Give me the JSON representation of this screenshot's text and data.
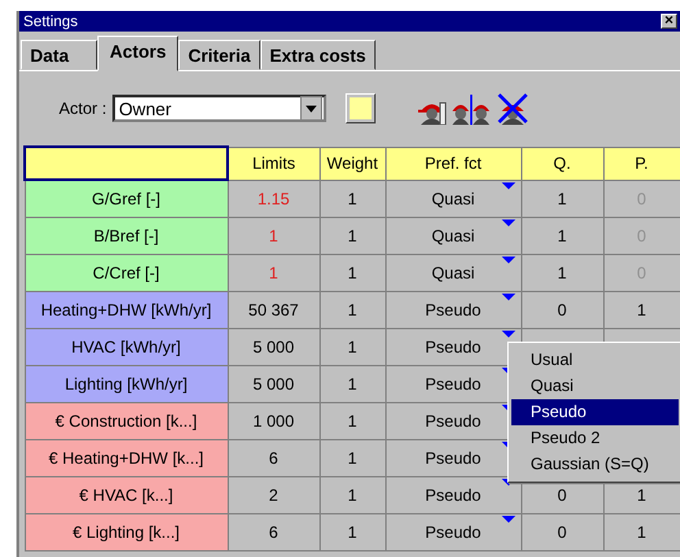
{
  "window": {
    "title": "Settings",
    "close": "×"
  },
  "tabs": [
    {
      "label": "Data",
      "selected": false
    },
    {
      "label": "Actors",
      "selected": true
    },
    {
      "label": "Criteria",
      "selected": false
    },
    {
      "label": "Extra costs",
      "selected": false
    }
  ],
  "actor": {
    "label": "Actor :",
    "value": "Owner",
    "color": "#ffff99"
  },
  "table": {
    "columns": [
      "",
      "Limits",
      "Weight",
      "Pref. fct",
      "Q.",
      "P."
    ],
    "rows": [
      {
        "name": "G/Gref [-]",
        "color": "#a8f8a8",
        "limit": "1.15",
        "limit_alert": true,
        "weight": "1",
        "pref": "Quasi",
        "q": "1",
        "p": "0",
        "p_disabled": true
      },
      {
        "name": "B/Bref [-]",
        "color": "#a8f8a8",
        "limit": "1",
        "limit_alert": true,
        "weight": "1",
        "pref": "Quasi",
        "q": "1",
        "p": "0",
        "p_disabled": true
      },
      {
        "name": "C/Cref [-]",
        "color": "#a8f8a8",
        "limit": "1",
        "limit_alert": true,
        "weight": "1",
        "pref": "Quasi",
        "q": "1",
        "p": "0",
        "p_disabled": true
      },
      {
        "name": "Heating+DHW [kWh/yr]",
        "color": "#a8a8f8",
        "limit": "50 367",
        "limit_alert": false,
        "weight": "1",
        "pref": "Pseudo",
        "q": "0",
        "p": "1",
        "p_disabled": false
      },
      {
        "name": "HVAC [kWh/yr]",
        "color": "#a8a8f8",
        "limit": "5 000",
        "limit_alert": false,
        "weight": "1",
        "pref": "Pseudo"
      },
      {
        "name": "Lighting [kWh/yr]",
        "color": "#a8a8f8",
        "limit": "5 000",
        "limit_alert": false,
        "weight": "1",
        "pref": "Pseudo"
      },
      {
        "name": "€ Construction [k...]",
        "color": "#f8a8a8",
        "limit": "1 000",
        "limit_alert": false,
        "weight": "1",
        "pref": "Pseudo"
      },
      {
        "name": "€ Heating+DHW [k...]",
        "color": "#f8a8a8",
        "limit": "6",
        "limit_alert": false,
        "weight": "1",
        "pref": "Pseudo"
      },
      {
        "name": "€ HVAC [k...]",
        "color": "#f8a8a8",
        "limit": "2",
        "limit_alert": false,
        "weight": "1",
        "pref": "Pseudo",
        "q": "0",
        "p": "1",
        "p_disabled": false
      },
      {
        "name": "€ Lighting [k...]",
        "color": "#f8a8a8",
        "limit": "6",
        "limit_alert": false,
        "weight": "1",
        "pref": "Pseudo",
        "q": "0",
        "p": "1",
        "p_disabled": false
      }
    ]
  },
  "popup_menu": {
    "items": [
      {
        "label": "Usual",
        "selected": false
      },
      {
        "label": "Quasi",
        "selected": false
      },
      {
        "label": "Pseudo",
        "selected": true
      },
      {
        "label": "Pseudo 2",
        "selected": false
      },
      {
        "label": "Gaussian (S=Q)",
        "selected": false
      }
    ]
  }
}
